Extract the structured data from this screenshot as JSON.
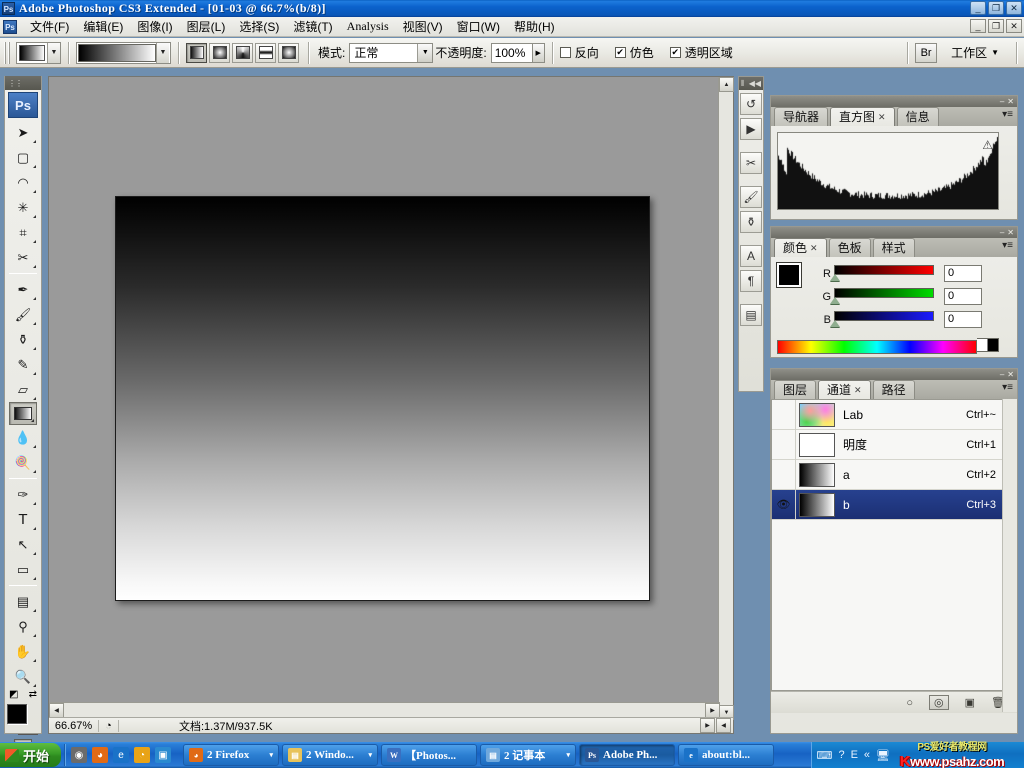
{
  "window": {
    "title": "Adobe Photoshop CS3 Extended - [01-03 @ 66.7%(b/8)]",
    "app_icon": "Ps",
    "minimize": "_",
    "maximize": "❐",
    "close": "✕"
  },
  "menubar": {
    "doc_icon": "Ps",
    "items": [
      {
        "label": "文件(F)",
        "name": "menu-file"
      },
      {
        "label": "编辑(E)",
        "name": "menu-edit"
      },
      {
        "label": "图像(I)",
        "name": "menu-image"
      },
      {
        "label": "图层(L)",
        "name": "menu-layer"
      },
      {
        "label": "选择(S)",
        "name": "menu-select"
      },
      {
        "label": "滤镜(T)",
        "name": "menu-filter"
      },
      {
        "label": "Analysis",
        "name": "menu-analysis"
      },
      {
        "label": "视图(V)",
        "name": "menu-view"
      },
      {
        "label": "窗口(W)",
        "name": "menu-window"
      },
      {
        "label": "帮助(H)",
        "name": "menu-help"
      }
    ],
    "doc_minimize": "_",
    "doc_maximize": "❐",
    "doc_close": "✕"
  },
  "options_bar": {
    "gradient_picker_label": "gradient-preset",
    "dropdown_arrow": "▼",
    "gradient_types": [
      {
        "name": "linear-gradient-button",
        "active": true
      },
      {
        "name": "radial-gradient-button",
        "active": false
      },
      {
        "name": "angle-gradient-button",
        "active": false
      },
      {
        "name": "reflected-gradient-button",
        "active": false
      },
      {
        "name": "diamond-gradient-button",
        "active": false
      }
    ],
    "mode_label": "模式:",
    "mode_value": "正常",
    "opacity_label": "不透明度:",
    "opacity_value": "100%",
    "opacity_arrow": "▶",
    "checkboxes": [
      {
        "label": "反向",
        "checked": false,
        "name": "reverse-checkbox"
      },
      {
        "label": "仿色",
        "checked": true,
        "name": "dither-checkbox"
      },
      {
        "label": "透明区域",
        "checked": true,
        "name": "transparency-checkbox"
      }
    ],
    "bridge_icon": "Br",
    "workspace_label": "工作区",
    "workspace_arrow": "▼"
  },
  "toolbar": {
    "logo": "Ps",
    "grip": "⋮⋮",
    "tools": [
      {
        "name": "move-tool",
        "glyph": "➤",
        "sel": false,
        "sep": false
      },
      {
        "name": "marquee-tool",
        "glyph": "▢",
        "sel": false,
        "sep": false
      },
      {
        "name": "lasso-tool",
        "glyph": "◠",
        "sel": false,
        "sep": false
      },
      {
        "name": "magic-wand-tool",
        "glyph": "✳",
        "sel": false,
        "sep": false
      },
      {
        "name": "crop-tool",
        "glyph": "⌗",
        "sel": false,
        "sep": false
      },
      {
        "name": "slice-tool",
        "glyph": "✂",
        "sel": false,
        "sep": true
      },
      {
        "name": "healing-brush-tool",
        "glyph": "✒",
        "sel": false,
        "sep": false
      },
      {
        "name": "brush-tool",
        "glyph": "🖌",
        "sel": false,
        "sep": false
      },
      {
        "name": "clone-stamp-tool",
        "glyph": "⚱",
        "sel": false,
        "sep": false
      },
      {
        "name": "history-brush-tool",
        "glyph": "✎",
        "sel": false,
        "sep": false
      },
      {
        "name": "eraser-tool",
        "glyph": "▱",
        "sel": false,
        "sep": false
      },
      {
        "name": "gradient-tool",
        "glyph": "▤",
        "sel": true,
        "sep": false
      },
      {
        "name": "blur-tool",
        "glyph": "💧",
        "sel": false,
        "sep": false
      },
      {
        "name": "dodge-tool",
        "glyph": "🍭",
        "sel": false,
        "sep": true
      },
      {
        "name": "pen-tool",
        "glyph": "✑",
        "sel": false,
        "sep": false
      },
      {
        "name": "type-tool",
        "glyph": "T",
        "sel": false,
        "sep": false
      },
      {
        "name": "path-selection-tool",
        "glyph": "↖",
        "sel": false,
        "sep": false
      },
      {
        "name": "shape-tool",
        "glyph": "▭",
        "sel": false,
        "sep": true
      },
      {
        "name": "notes-tool",
        "glyph": "▤",
        "sel": false,
        "sep": false
      },
      {
        "name": "eyedropper-tool",
        "glyph": "⚲",
        "sel": false,
        "sep": false
      },
      {
        "name": "hand-tool",
        "glyph": "✋",
        "sel": false,
        "sep": false
      },
      {
        "name": "zoom-tool",
        "glyph": "🔍",
        "sel": false,
        "sep": false
      }
    ],
    "foreground_color": "#000000",
    "background_color": "#ffffff",
    "default_colors_icon": "◩",
    "swap_colors_icon": "⇄",
    "quickmask_standard": "◎",
    "quickmask_mask": "◧",
    "screen_mode_icon": "▣"
  },
  "document": {
    "canvas_gradient_from": "#000000",
    "canvas_gradient_to": "#ffffff",
    "zoom": "66.67%",
    "doc_size": "文档:1.37M/937.5K",
    "scroll_right": "▶",
    "scroll_left": "◀",
    "scroll_up": "▲",
    "scroll_down": "▼"
  },
  "dock_strip": {
    "collapse_icon": "◀◀",
    "grip": "⦀",
    "buttons": [
      {
        "name": "history-panel-icon",
        "glyph": "↺"
      },
      {
        "name": "actions-panel-icon",
        "glyph": "▶"
      },
      {
        "name": "tool-presets-panel-icon",
        "glyph": "✂"
      },
      {
        "name": "brushes-panel-icon",
        "glyph": "🖌"
      },
      {
        "name": "clone-source-panel-icon",
        "glyph": "⚱"
      },
      {
        "name": "character-panel-icon",
        "glyph": "A"
      },
      {
        "name": "paragraph-panel-icon",
        "glyph": "¶"
      },
      {
        "name": "layer-comps-panel-icon",
        "glyph": "▤"
      }
    ]
  },
  "histogram_panel": {
    "tabs": [
      {
        "label": "导航器",
        "active": false,
        "closable": false,
        "name": "tab-navigator"
      },
      {
        "label": "直方图",
        "active": true,
        "closable": true,
        "name": "tab-histogram"
      },
      {
        "label": "信息",
        "active": false,
        "closable": false,
        "name": "tab-info"
      }
    ],
    "warning_icon": "⚠",
    "minimize": "–",
    "close": "✕",
    "menu": "▾≡"
  },
  "color_panel": {
    "tabs": [
      {
        "label": "颜色",
        "active": true,
        "closable": true,
        "name": "tab-color"
      },
      {
        "label": "色板",
        "active": false,
        "closable": false,
        "name": "tab-swatches"
      },
      {
        "label": "样式",
        "active": false,
        "closable": false,
        "name": "tab-styles"
      }
    ],
    "foreground_color": "#000000",
    "background_color": "#ffffff",
    "channels": [
      {
        "label": "R",
        "value": "0",
        "name": "red-slider"
      },
      {
        "label": "G",
        "value": "0",
        "name": "green-slider"
      },
      {
        "label": "B",
        "value": "0",
        "name": "blue-slider"
      }
    ],
    "minimize": "–",
    "close": "✕",
    "menu": "▾≡"
  },
  "channels_panel": {
    "tabs": [
      {
        "label": "图层",
        "active": false,
        "closable": false,
        "name": "tab-layers"
      },
      {
        "label": "通道",
        "active": true,
        "closable": true,
        "name": "tab-channels"
      },
      {
        "label": "路径",
        "active": false,
        "closable": false,
        "name": "tab-paths"
      }
    ],
    "rows": [
      {
        "name": "Lab",
        "shortcut": "Ctrl+~",
        "visible": false,
        "selected": false,
        "thumb": "lab"
      },
      {
        "name": "明度",
        "shortcut": "Ctrl+1",
        "visible": false,
        "selected": false,
        "thumb": "white"
      },
      {
        "name": "a",
        "shortcut": "Ctrl+2",
        "visible": false,
        "selected": false,
        "thumb": "grad"
      },
      {
        "name": "b",
        "shortcut": "Ctrl+3",
        "visible": true,
        "selected": true,
        "thumb": "grad"
      }
    ],
    "eye_icon": "👁",
    "footer_buttons": [
      {
        "name": "load-channel-as-selection-button",
        "glyph": "○"
      },
      {
        "name": "save-selection-as-channel-button",
        "glyph": "◎"
      },
      {
        "name": "new-channel-button",
        "glyph": "▣"
      },
      {
        "name": "delete-channel-button",
        "glyph": "🗑"
      }
    ],
    "minimize": "–",
    "close": "✕",
    "menu": "▾≡"
  },
  "taskbar": {
    "start_label": "开始",
    "quick_launch": [
      {
        "name": "ql-media-icon",
        "glyph": "◉",
        "color": "#6b6b6b"
      },
      {
        "name": "ql-firefox-icon",
        "glyph": "◕",
        "color": "#e06a16"
      },
      {
        "name": "ql-ie-icon",
        "glyph": "e",
        "color": "#1a72c8"
      },
      {
        "name": "ql-clock-icon",
        "glyph": "◔",
        "color": "#e8a317"
      },
      {
        "name": "ql-desktop-icon",
        "glyph": "▣",
        "color": "#2a8ad0"
      }
    ],
    "tasks": [
      {
        "label": "2 Firefox",
        "icon": "◕",
        "icon_color": "#e06a16",
        "arrow": "▾",
        "active": false,
        "name": "taskbar-firefox"
      },
      {
        "label": "2 Windo...",
        "icon": "▤",
        "icon_color": "#e8c35a",
        "arrow": "▾",
        "active": false,
        "name": "taskbar-windows-explorer"
      },
      {
        "label": "【Photos...",
        "icon": "W",
        "icon_color": "#3a6fc0",
        "arrow": "",
        "active": false,
        "name": "taskbar-word-doc"
      },
      {
        "label": "2 记事本",
        "icon": "▤",
        "icon_color": "#6fa8dc",
        "arrow": "▾",
        "active": false,
        "name": "taskbar-notepad"
      },
      {
        "label": "Adobe Ph...",
        "icon": "Ps",
        "icon_color": "#2a5796",
        "arrow": "",
        "active": true,
        "name": "taskbar-photoshop"
      },
      {
        "label": "about:bl...",
        "icon": "e",
        "icon_color": "#1a72c8",
        "arrow": "",
        "active": false,
        "name": "taskbar-ie-blank"
      }
    ],
    "tray": [
      {
        "name": "keyboard-tray-icon",
        "glyph": "⌨"
      },
      {
        "name": "help-tray-icon",
        "glyph": "?"
      },
      {
        "name": "ime-tray-icon",
        "glyph": "E"
      },
      {
        "name": "expand-tray-icon",
        "glyph": "«"
      },
      {
        "name": "network-tray-icon",
        "glyph": "🖥"
      }
    ],
    "watermark_top": "PS爱好者教程网",
    "watermark_prefix": "K",
    "watermark_bottom": "www.psahz.com"
  }
}
